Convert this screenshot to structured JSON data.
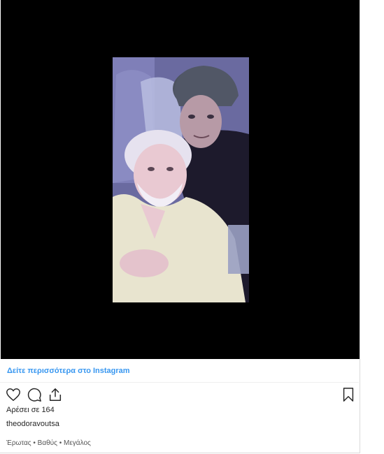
{
  "post": {
    "view_more_label": "Δείτε περισσότερα στο Instagram",
    "likes_text": "Αρέσει σε 164",
    "username": "theodoravoutsa",
    "caption": "Έρωτας • Βαθύς • Μεγάλος"
  },
  "icons": {
    "like": "heart-icon",
    "comment": "comment-bubble-icon",
    "share": "share-upload-icon",
    "save": "bookmark-icon"
  },
  "colors": {
    "link": "#3897f0",
    "text": "#262626",
    "video_background": "#000000"
  }
}
